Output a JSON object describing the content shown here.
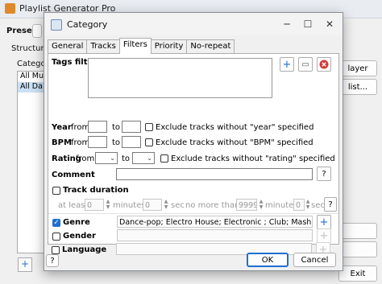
{
  "main_window": {
    "title": "Playlist Generator Pro",
    "preset_label": "Preset",
    "structure_label": "Structure",
    "category_label": "Catego",
    "list_items": [
      "All Mu",
      "All Da"
    ],
    "player_button": "layer",
    "ellipsis_button": "list...",
    "exit_button": "Exit"
  },
  "dialog": {
    "title": "Category",
    "tabs": [
      "General",
      "Tracks",
      "Filters",
      "Priority",
      "No-repeat"
    ],
    "active_tab": "Filters",
    "tags_filter_label": "Tags filter",
    "year": {
      "label": "Year",
      "from": "from",
      "to": "to",
      "exclude": "Exclude tracks without \"year\" specified"
    },
    "bpm": {
      "label": "BPM",
      "from": "from",
      "to": "to",
      "exclude": "Exclude tracks without \"BPM\" specified"
    },
    "rating": {
      "label": "Rating",
      "from": "from",
      "to": "to",
      "exclude": "Exclude tracks without \"rating\" specified"
    },
    "comment_label": "Comment",
    "comment_help": "?",
    "track_duration": {
      "label": "Track duration",
      "at_least": "at least",
      "min_value": "0",
      "minutes": "minutes",
      "sec_value": "0",
      "sec": "sec",
      "no_more_than": "no more than",
      "max_min_value": "9999",
      "max_minutes": "minutes",
      "max_sec_value": "0",
      "max_sec": "sec",
      "help": "?"
    },
    "genre": {
      "label": "Genre",
      "checked": true,
      "value": "Dance-pop; Electro House; Electronic ; Club; Mash; Trance"
    },
    "gender": {
      "label": "Gender",
      "checked": false
    },
    "language": {
      "label": "Language",
      "checked": false
    },
    "help_button": "?",
    "ok_button": "OK",
    "cancel_button": "Cancel",
    "icons": {
      "add": "+",
      "edit": "edit-icon",
      "delete": "delete-icon"
    },
    "colors": {
      "accent": "#1f6fd1",
      "delete": "#d43a3a"
    }
  }
}
